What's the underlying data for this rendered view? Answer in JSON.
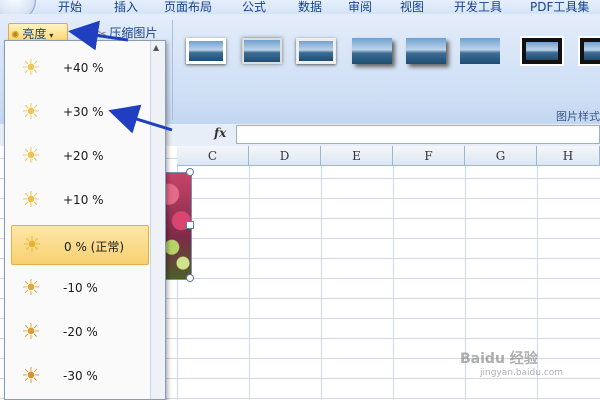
{
  "menu": {
    "tabs": [
      "开始",
      "插入",
      "页面布局",
      "公式",
      "数据",
      "审阅",
      "视图",
      "开发工具",
      "PDF工具集"
    ]
  },
  "ribbon": {
    "brightness_label": "亮度",
    "compress_label": "压缩图片",
    "styles_group_label": "图片样式"
  },
  "formula_bar": {
    "fx_label": "fx",
    "value": ""
  },
  "columns": [
    "C",
    "D",
    "E",
    "F",
    "G",
    "H"
  ],
  "brightness_menu": {
    "items": [
      {
        "label": "+40 %",
        "selected": false
      },
      {
        "label": "+30 %",
        "selected": false
      },
      {
        "label": "+20 %",
        "selected": false
      },
      {
        "label": "+10 %",
        "selected": false
      },
      {
        "label": "0 % (正常)",
        "selected": true
      },
      {
        "label": "-10 %",
        "selected": false
      },
      {
        "label": "-20 %",
        "selected": false
      },
      {
        "label": "-30 %",
        "selected": false
      }
    ]
  },
  "colors": {
    "accent": "#15428b",
    "highlight": "#f8d070",
    "arrow": "#1f3fc0"
  },
  "watermark": {
    "text": "Baidu 经验",
    "sub": "jingyan.baidu.com"
  }
}
